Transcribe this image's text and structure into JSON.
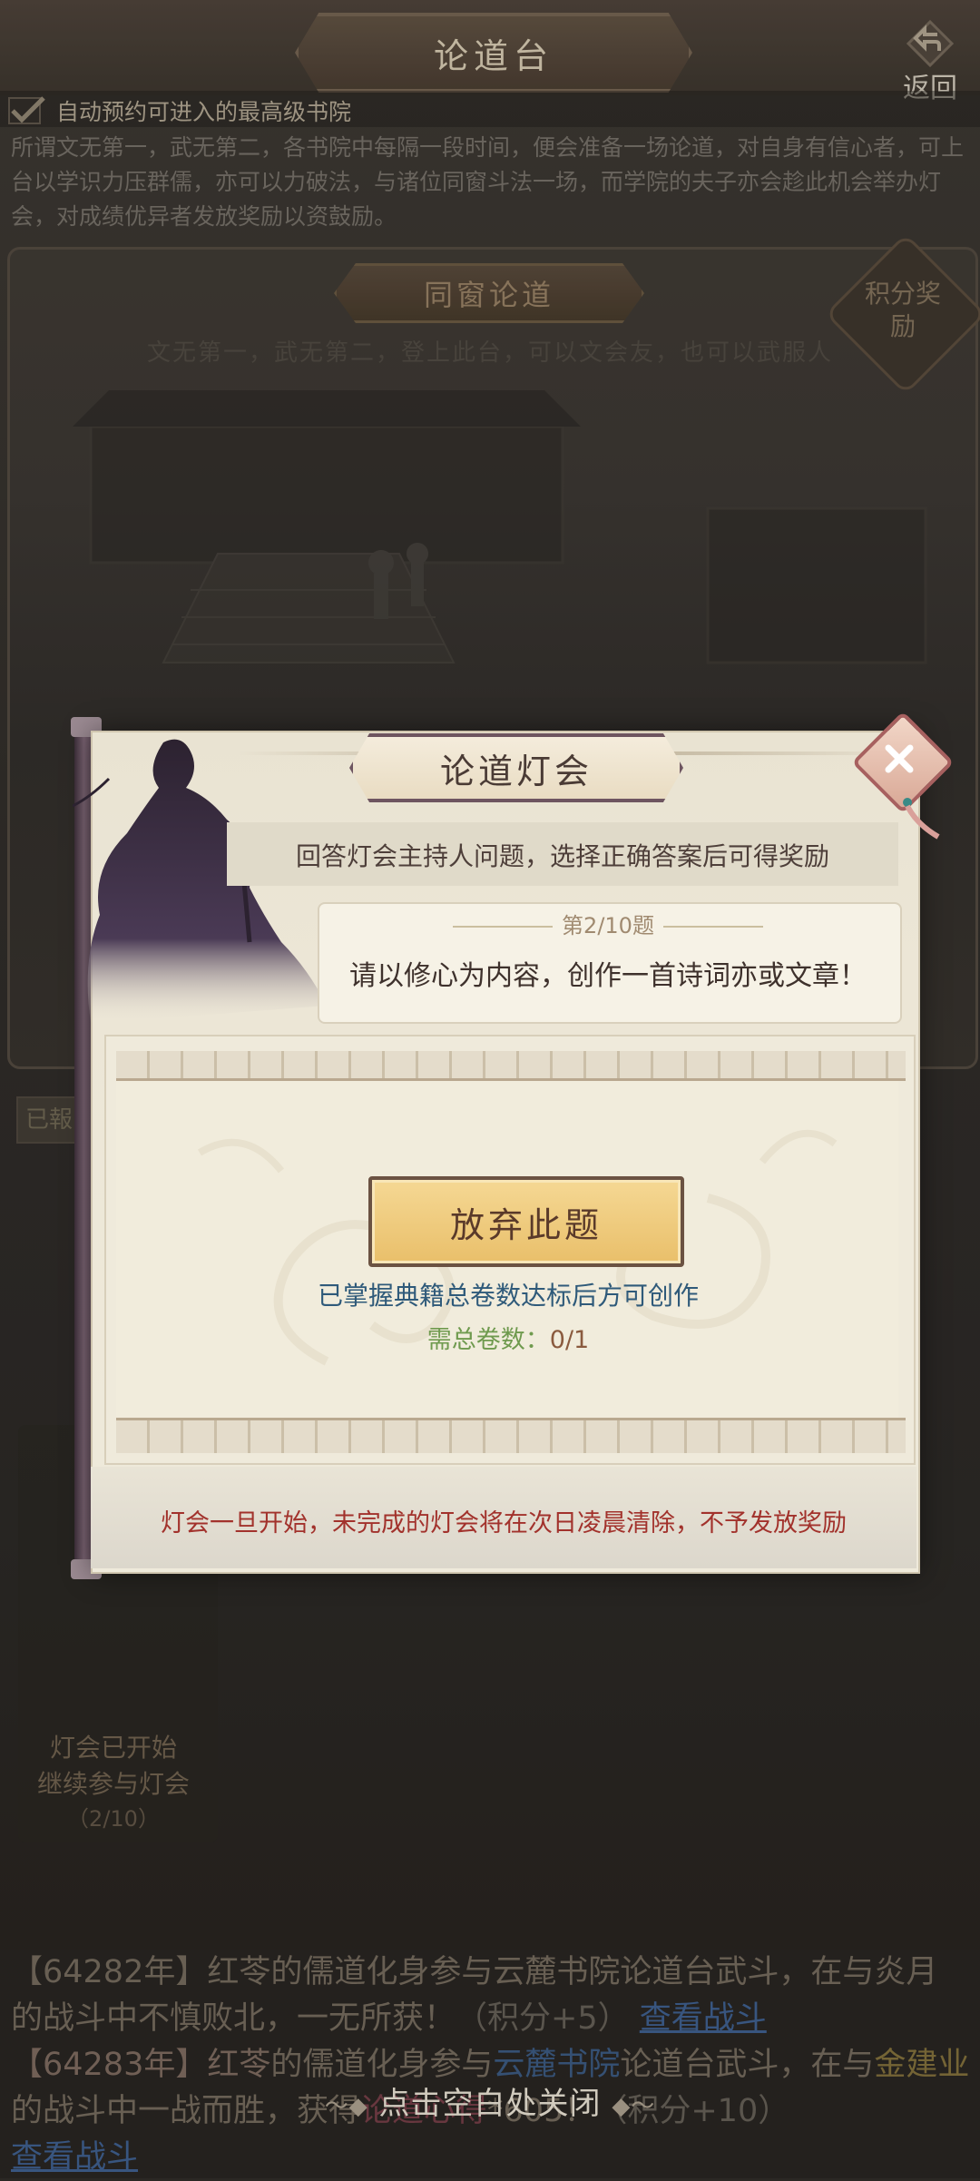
{
  "header": {
    "title": "论道台",
    "back_label": "返回"
  },
  "auto_reserve": {
    "label": "自动预约可进入的最高级书院",
    "checked": true
  },
  "intro": "所谓文无第一，武无第二，各书院中每隔一段时间，便会准备一场论道，对自身有信心者，可上台以学识力压群儒，亦可以力破法，与诸位同窗斗法一场，而学院的夫子亦会趁此机会举办灯会，对成绩优异者发放奖励以资鼓励。",
  "scene": {
    "title": "同窗论道",
    "subtitle": "文无第一，武无第二，登上此台，可以文会友，也可以武服人",
    "reward_label": "积分奖励",
    "left_tag": "已報"
  },
  "lantern_card": {
    "status": "灯会已开始\n继续参与灯会",
    "progress": "（2/10）"
  },
  "log": {
    "entry1_line": "【64282年】红苓的儒道化身参与云麓书院论道台武斗，在与炎月",
    "entry1_tail": "的战斗中不慎败北，一无所获！",
    "entry1_score": "（积分+5）",
    "entry1_link": "查看战斗",
    "entry2_year": "【64283年】",
    "entry2_name": "红苓",
    "entry2_a": "的儒道化身参与",
    "entry2_place": "云麓书院",
    "entry2_b": "论道台武斗，在与",
    "entry2_rival": "金建业",
    "entry2_c": "的战斗中一战而胜，获得",
    "entry2_reward": "论道心得",
    "entry2_amount": "*605！",
    "entry2_score": "（积分+10）",
    "entry2_link": "查看战斗"
  },
  "tap_close": "点击空白处关闭",
  "dialog": {
    "title": "论道灯会",
    "instruction": "回答灯会主持人问题，选择正确答案后可得奖励",
    "question_number": "第2/10题",
    "question": "请以修心为内容，创作一首诗词亦或文章！",
    "abandon_label": "放弃此题",
    "requirement": "已掌握典籍总卷数达标后方可创作",
    "count_label": "需总卷数：",
    "count_value": "0/1",
    "warning": "灯会一旦开始，未完成的灯会将在次日凌晨清除，不予发放奖励"
  },
  "icons": {
    "back": "back-arrow-icon",
    "check": "checkmark-icon",
    "close": "close-x-icon"
  },
  "colors": {
    "warning": "#a2322c",
    "requirement": "#2f5a7a",
    "count": "#6f9a4e",
    "abandon_button": "#e9bf6a"
  }
}
